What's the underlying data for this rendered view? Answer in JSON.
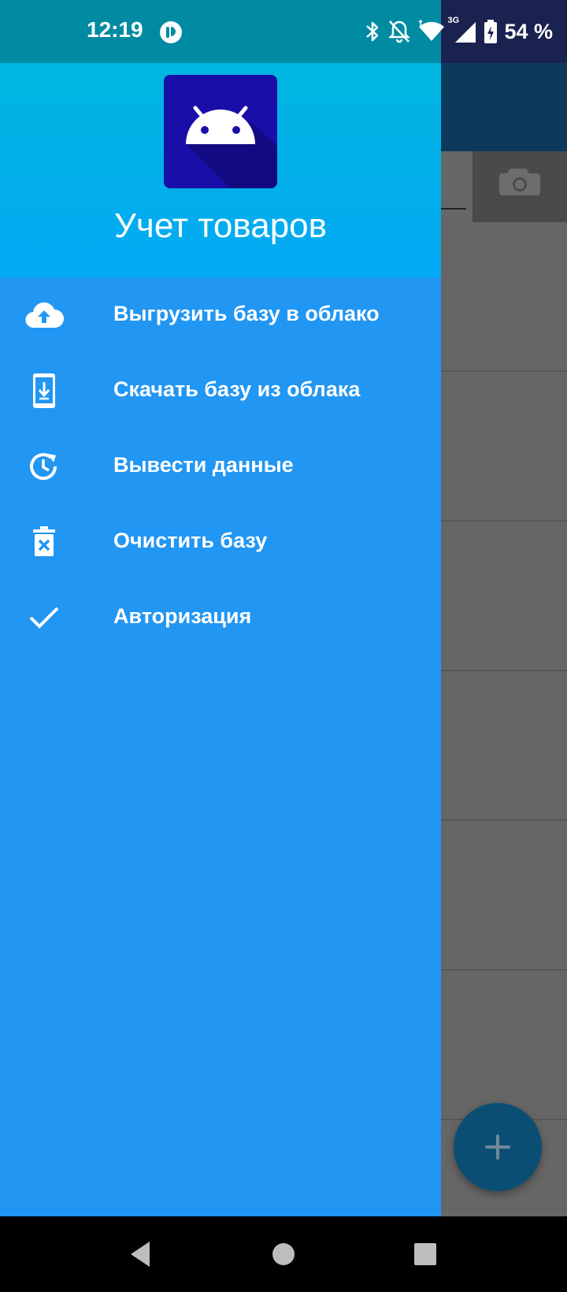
{
  "status_bar": {
    "time": "12:19",
    "battery": "54 %",
    "icons": [
      "app-notification-icon",
      "bluetooth-icon",
      "notifications-off-icon",
      "wifi-icon",
      "cellular-3g-icon",
      "battery-charging-icon"
    ],
    "network_label": "3G"
  },
  "drawer": {
    "app_title": "Учет товаров",
    "items": [
      {
        "label": "Выгрузить базу в облако",
        "icon": "cloud-upload-icon"
      },
      {
        "label": "Скачать базу из облака",
        "icon": "phone-download-icon"
      },
      {
        "label": "Вывести данные",
        "icon": "history-icon"
      },
      {
        "label": "Очистить базу",
        "icon": "delete-icon"
      },
      {
        "label": "Авторизация",
        "icon": "check-icon"
      }
    ]
  },
  "background_app": {
    "toolbar_overflow": "more-vert-icon",
    "camera_button": "camera-icon",
    "fab_icon": "add-icon"
  },
  "colors": {
    "drawer_bg": "#2196f3",
    "header_bg": "#03a9f4",
    "app_icon_bg": "#1a0ea8",
    "status_left": "#008ba3",
    "status_right": "#1a2250"
  },
  "nav_bar": [
    "back-icon",
    "home-icon",
    "recents-icon"
  ]
}
